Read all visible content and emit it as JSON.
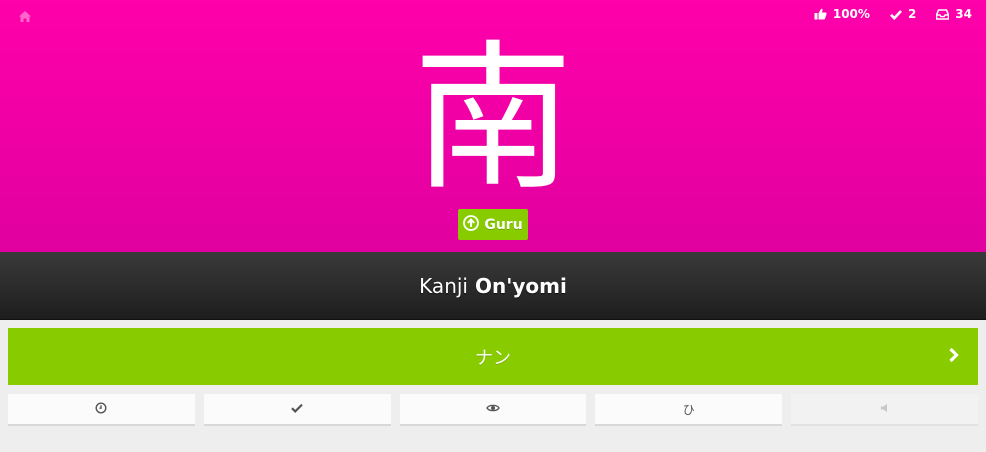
{
  "header": {
    "background_color": "#ff00aa",
    "home_icon": "home-icon",
    "stats": {
      "percent_correct": "100%",
      "done_count": "2",
      "queue_count": "34"
    }
  },
  "character": "南",
  "srs": {
    "label": "Guru",
    "icon": "arrow-up-circle-icon",
    "color": "#88cc00"
  },
  "question": {
    "item_type": "Kanji",
    "reading_type": "On'yomi"
  },
  "answer": {
    "value": "ナン",
    "color": "#88cc00",
    "submit_icon": "chevron-right-icon"
  },
  "actions": [
    {
      "name": "last-items",
      "icon": "clock-icon",
      "glyph": "◷"
    },
    {
      "name": "item-info-check",
      "icon": "check-icon",
      "glyph": "✔"
    },
    {
      "name": "item-info",
      "icon": "eye-icon",
      "glyph": ""
    },
    {
      "name": "kana-chart",
      "icon": "hiragana-icon",
      "glyph": "ひ"
    },
    {
      "name": "audio",
      "icon": "speaker-icon",
      "glyph": "",
      "disabled": true
    }
  ]
}
